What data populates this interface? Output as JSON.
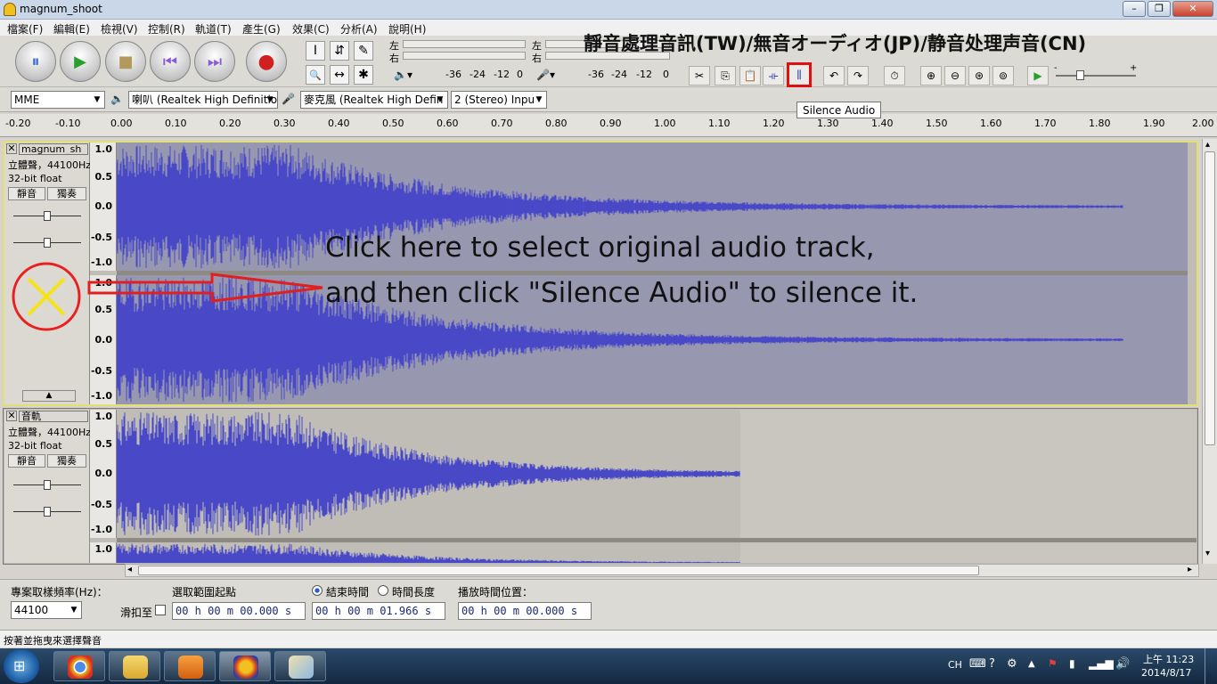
{
  "window": {
    "title": "magnum_shoot",
    "min": "–",
    "max": "❐",
    "close": "✕"
  },
  "menu": [
    "檔案(F)",
    "編輯(E)",
    "檢視(V)",
    "控制(R)",
    "軌道(T)",
    "產生(G)",
    "效果(C)",
    "分析(A)",
    "說明(H)"
  ],
  "transport": {
    "pause": "⏸",
    "play": "▶",
    "stop": "■",
    "skip_start": "⏮",
    "skip_end": "⏭",
    "record": "●"
  },
  "tools": {
    "select": "I",
    "envelope": "⇵",
    "draw": "✎",
    "zoom": "🔍",
    "timeshift": "↔",
    "multi": "✱"
  },
  "meters": {
    "play_left": "左",
    "play_right": "右",
    "rec_left": "左",
    "rec_right": "右",
    "play_scale": [
      "-36",
      "-24",
      "-12",
      "0"
    ],
    "rec_scale": [
      "-36",
      "-24",
      "-12",
      "0"
    ]
  },
  "annotations": {
    "header_note": "靜音處理音訊(TW)/無音オーディオ(JP)/静音处理声音(CN)",
    "line1": "Click here to select original audio track,",
    "line2": "and then click \"Silence Audio\" to silence it."
  },
  "tooltip": "Silence Audio",
  "devices": {
    "host": "MME",
    "output": "喇叭 (Realtek High Definitio",
    "input": "麥克風 (Realtek High Defin",
    "channels": "2 (Stereo) Inpu"
  },
  "ruler": [
    "-0.20",
    "-0.10",
    "0.00",
    "0.10",
    "0.20",
    "0.30",
    "0.40",
    "0.50",
    "0.60",
    "0.70",
    "0.80",
    "0.90",
    "1.00",
    "1.10",
    "1.20",
    "1.30",
    "1.40",
    "1.50",
    "1.60",
    "1.70",
    "1.80",
    "1.90",
    "2.00"
  ],
  "tracks": [
    {
      "name": "magnum_sh",
      "info": "立體聲，44100Hz",
      "format": "32-bit float",
      "mute": "靜音",
      "solo": "獨奏",
      "scale": [
        "1.0",
        "0.5",
        "0.0",
        "-0.5",
        "-1.0"
      ],
      "scale2": [
        "1.0",
        "0.5",
        "0.0",
        "-0.5",
        "-1.0"
      ]
    },
    {
      "name": "音軌",
      "info": "立體聲，44100Hz",
      "format": "32-bit float",
      "mute": "靜音",
      "solo": "獨奏",
      "scale": [
        "1.0",
        "0.5",
        "0.0",
        "-0.5",
        "-1.0"
      ],
      "scale2": [
        "1.0"
      ]
    }
  ],
  "colors": {
    "wave": "#4949c8",
    "selected_bg": "#9897b0",
    "unselected_bg": "#c9c6bf",
    "arrow": "#e02020",
    "x_mark": "#f5e21a"
  },
  "selection_bar": {
    "rate_label": "專案取樣頻率(Hz)：",
    "rate_value": "44100",
    "snap_label": "滑扣至",
    "start_label": "選取範圍起點",
    "end_label": "結束時間",
    "length_label": "時間長度",
    "pos_label": "播放時間位置：",
    "start_time": "00 h 00 m 00.000 s",
    "end_time": "00 h 00 m 01.966 s",
    "pos_time": "00 h 00 m 00.000 s"
  },
  "status": "按著並拖曳來選擇聲音",
  "tray": {
    "lang": "CH",
    "time": "上午 11:23",
    "date": "2014/8/17"
  }
}
